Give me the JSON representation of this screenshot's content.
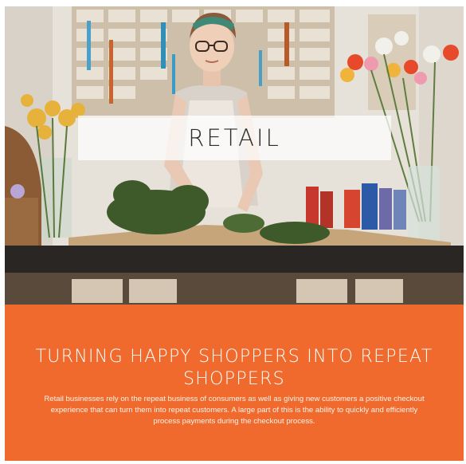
{
  "photo": {
    "alt_subject": "florist-arranging-greenery"
  },
  "banner": {
    "label": "RETAIL"
  },
  "info": {
    "headline": "TURNING HAPPY SHOPPERS INTO REPEAT SHOPPERS",
    "body": "Retail businesses rely on the repeat business of consumers as well as giving new customers a positive checkout experience that can turn them into repeat customers.  A large part of this is the ability to quickly and efficiently process payments during the checkout process."
  },
  "colors": {
    "accent_orange": "#f06a2d",
    "banner_text": "#2b2b2b",
    "counter_dark": "#2a2624"
  }
}
